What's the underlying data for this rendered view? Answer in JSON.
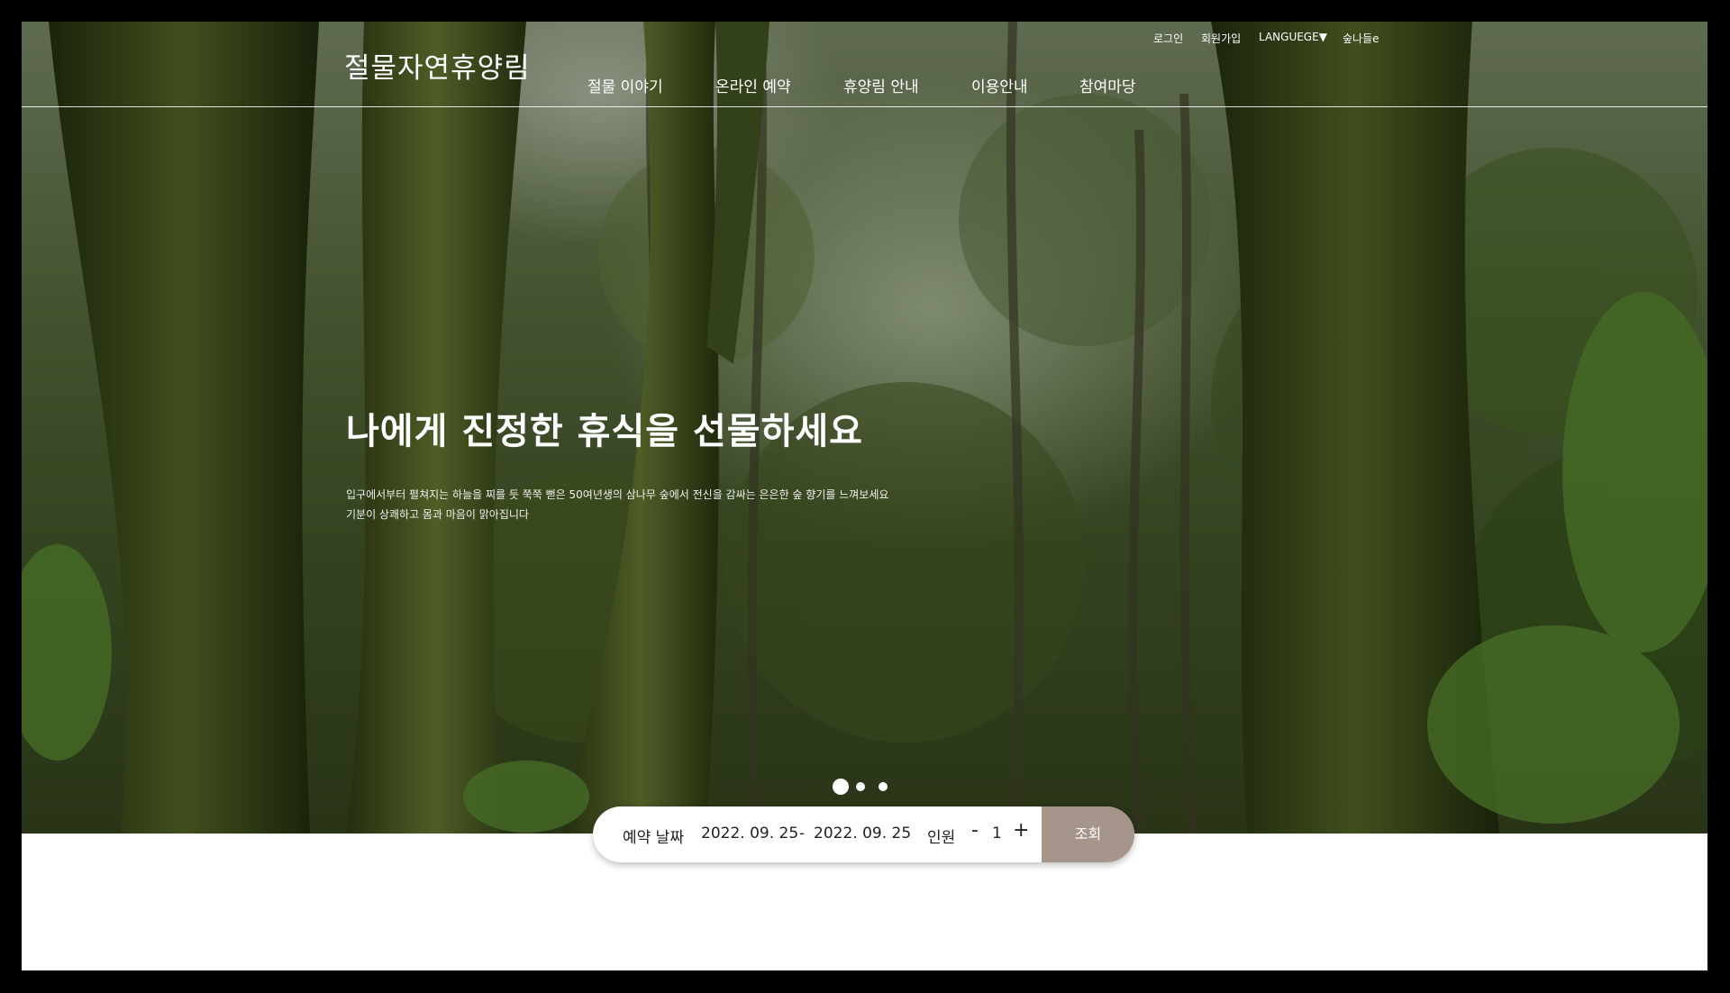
{
  "site": {
    "logo": "절물자연휴양림"
  },
  "utility_nav": {
    "login": "로그인",
    "signup": "회원가입",
    "language": "LANGUEGE▼",
    "forest_e": "숲나들e"
  },
  "main_nav": [
    {
      "label": "절물 이야기"
    },
    {
      "label": "온라인 예약"
    },
    {
      "label": "휴양림 안내"
    },
    {
      "label": "이용안내"
    },
    {
      "label": "참여마당"
    }
  ],
  "hero": {
    "title": "나에게 진정한 휴식을 선물하세요",
    "desc_line1": "입구에서부터 펼쳐지는 하늘을 찌를 듯 쭉쭉 뻗은 50여년생의 삼나무 숲에서 전신을 감싸는 은은한 숲 향기를 느껴보세요",
    "desc_line2": "기분이 상쾌하고 몸과 마음이 맑아집니다",
    "slides": {
      "count": 3,
      "active": 1
    }
  },
  "booking": {
    "date_label": "예약 날짜",
    "start_date": "2022. 09. 25",
    "separator": "-",
    "end_date": "2022. 09. 25",
    "people_label": "인원",
    "minus": "-",
    "count": "1",
    "plus": "+",
    "search_label": "조회"
  },
  "colors": {
    "search_button": "#a5958a",
    "frame": "#000000"
  }
}
